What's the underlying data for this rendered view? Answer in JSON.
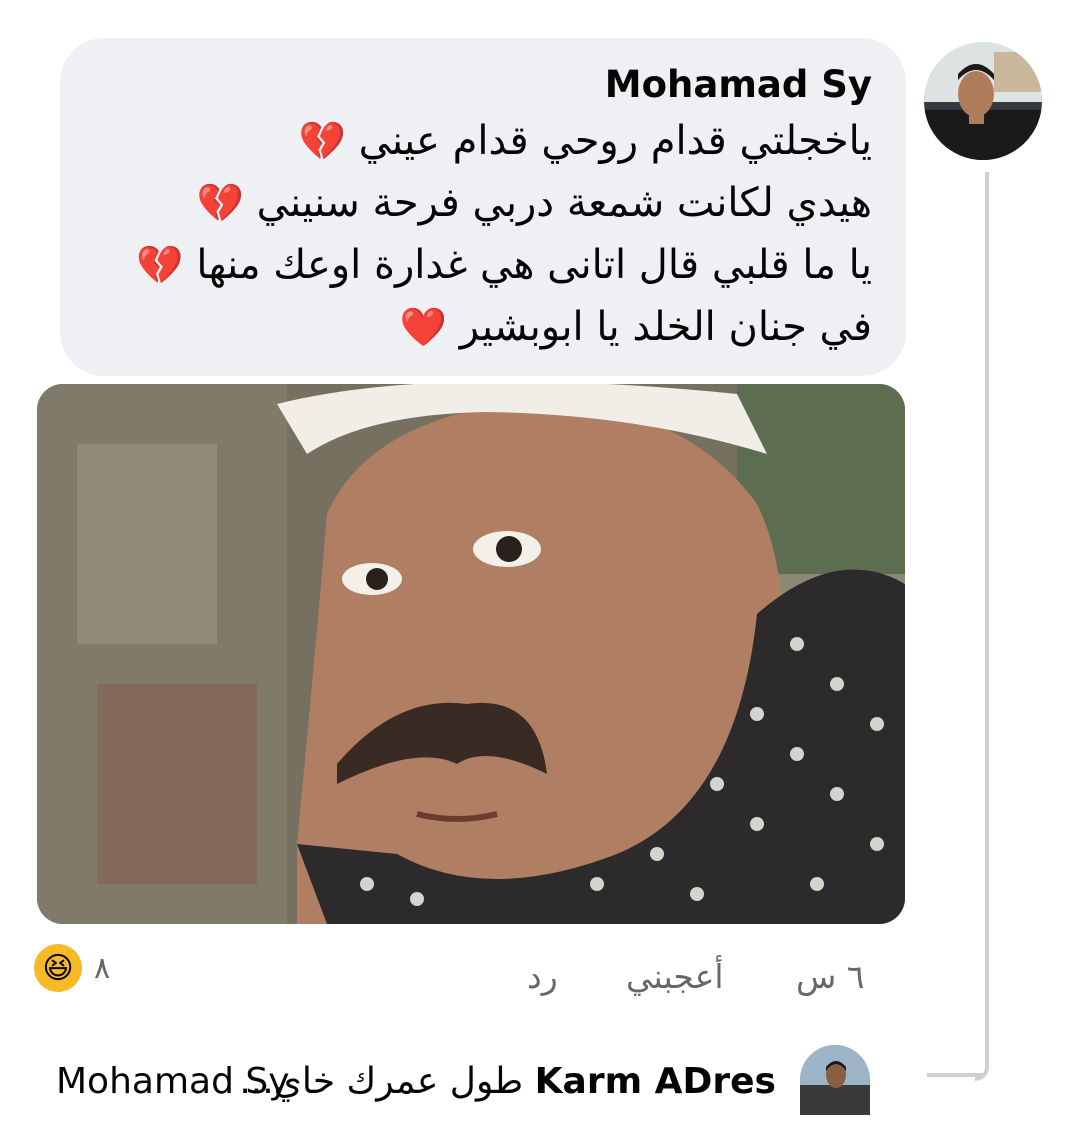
{
  "comment": {
    "author": "Mohamad Sy",
    "lines": [
      "ياخجلتي قدام روحي قدام عيني",
      "هيدي لكانت شمعة دربي فرحة سنيني",
      "يا ما قلبي قال اتانى هي غدارة اوعك منها",
      "في جنان الخلد يا ابوبشير"
    ],
    "line_emojis": [
      "💔",
      "💔",
      "💔",
      "❤️"
    ],
    "time": "٦ س",
    "like_label": "أعجبني",
    "reply_label": "رد",
    "reaction_icon": "😆",
    "reaction_count": "٨"
  },
  "reply": {
    "author": "Karm ADres",
    "text": "طول عمرك خاي...",
    "mention": "Mohamad Sy"
  },
  "colors": {
    "bubble": "#eef0f3",
    "meta_text": "#65676b",
    "reaction": "#f7b928",
    "thread_line": "#ced0d4"
  }
}
